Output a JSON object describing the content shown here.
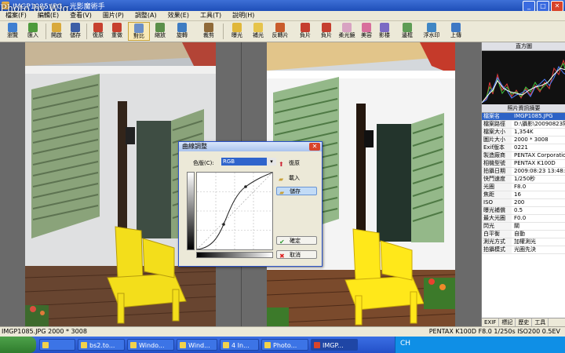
{
  "window": {
    "title": "IMGP1085.JPG - 光影魔術手"
  },
  "watermark": "Photo by Wlg ...",
  "menu": [
    "檔案(F)",
    "編輯(E)",
    "查看(V)",
    "圖片(P)",
    "調整(A)",
    "效果(E)",
    "工具(T)",
    "說明(H)"
  ],
  "toolbar": {
    "buttons": [
      {
        "label": "瀏覽",
        "icon": "browse-icon",
        "color": "#3f7fd1"
      },
      {
        "label": "匯入",
        "icon": "import-icon",
        "color": "#4e9a3c"
      },
      {
        "label": "開啟",
        "icon": "open-icon",
        "color": "#d9a93b"
      },
      {
        "label": "儲存",
        "icon": "save-icon",
        "color": "#3d5fa6"
      },
      {
        "label": "復原",
        "icon": "undo-icon",
        "color": "#c7412f"
      },
      {
        "label": "重做",
        "icon": "redo-icon",
        "color": "#c7412f"
      },
      {
        "label": "對比",
        "icon": "compare-icon",
        "color": "#6b8fc7"
      },
      {
        "label": "縮放",
        "icon": "zoom-icon",
        "color": "#5b8f4a"
      },
      {
        "label": "旋轉",
        "icon": "rotate-icon",
        "color": "#3e7cc2"
      },
      {
        "label": "裁剪",
        "icon": "crop-icon",
        "color": "#8f6a39"
      },
      {
        "label": "曝光",
        "icon": "exposure-icon",
        "color": "#e0b73a"
      },
      {
        "label": "補光",
        "icon": "fill-light-icon",
        "color": "#e6c44b"
      },
      {
        "label": "反轉片",
        "icon": "reversal-film-icon",
        "color": "#c95c2c"
      },
      {
        "label": "負片",
        "icon": "negative-icon",
        "color": "#c53e2f"
      },
      {
        "label": "負片",
        "icon": "negative-2-icon",
        "color": "#c53e2f"
      },
      {
        "label": "柔光鏡",
        "icon": "soft-light-icon",
        "color": "#d8a3c2"
      },
      {
        "label": "美容",
        "icon": "beauty-icon",
        "color": "#d86f9c"
      },
      {
        "label": "影楼",
        "icon": "studio-icon",
        "color": "#7b6ac4"
      },
      {
        "label": "邊框",
        "icon": "frame-icon",
        "color": "#5e9c55"
      },
      {
        "label": "浮水印",
        "icon": "watermark-icon",
        "color": "#3f86c4"
      },
      {
        "label": "上傳",
        "icon": "upload-icon",
        "color": "#3e78c4"
      }
    ]
  },
  "info_panel": {
    "histogram_title": "直方圖",
    "exif_title": "照片資訊摘要",
    "rows": [
      {
        "key": "檔案名",
        "value": "IMGP1085.JPG"
      },
      {
        "key": "檔案路徑",
        "value": "D:\\攝影\\20090823陽光海"
      },
      {
        "key": "檔案大小",
        "value": "1,354K"
      },
      {
        "key": "圖片大小",
        "value": "2000 * 3008"
      },
      {
        "key": "Exif版本",
        "value": "0221"
      },
      {
        "key": "製造廠商",
        "value": "PENTAX Corporation"
      },
      {
        "key": "相機型號",
        "value": "PENTAX K100D"
      },
      {
        "key": "拍攝日期",
        "value": "2009:08:23 13:48:28"
      },
      {
        "key": "快門速度",
        "value": "1/250秒"
      },
      {
        "key": "光圈",
        "value": "F8.0"
      },
      {
        "key": "焦距",
        "value": "16"
      },
      {
        "key": "ISO",
        "value": "200"
      },
      {
        "key": "曝光補償",
        "value": "0.5"
      },
      {
        "key": "最大光圈",
        "value": "F0.0"
      },
      {
        "key": "閃光",
        "value": "關"
      },
      {
        "key": "白平衡",
        "value": "自動"
      },
      {
        "key": "測光方式",
        "value": "加權測光"
      },
      {
        "key": "拍攝模式",
        "value": "光圈先決"
      }
    ],
    "tabs": [
      "EXIF",
      "標記",
      "歷史",
      "工具"
    ]
  },
  "status": {
    "left": "IMGP1085.JPG 2000 * 3008",
    "right": "PENTAX K100D F8.0 1/250s ISO200 0.5EV"
  },
  "dialog": {
    "title": "曲線調整",
    "channel_label": "色版(C):",
    "channel_value": "RGB",
    "buttons": [
      {
        "label": "復原",
        "icon": "reset-icon"
      },
      {
        "label": "載入",
        "icon": "load-icon"
      },
      {
        "label": "儲存",
        "icon": "save-curve-icon"
      },
      {
        "label": "確定",
        "icon": "ok-icon"
      },
      {
        "label": "取消",
        "icon": "cancel-icon"
      }
    ]
  },
  "taskbar": {
    "items": [
      "",
      "bs2.to...",
      "Windo...",
      "Wind...",
      "4 In...",
      "Photo...",
      "IMGP..."
    ],
    "tray_lang": "CH"
  },
  "colors": {
    "accent": "#2c62c6",
    "chair": "#f3de1b",
    "shutter": "#8aa37a"
  }
}
